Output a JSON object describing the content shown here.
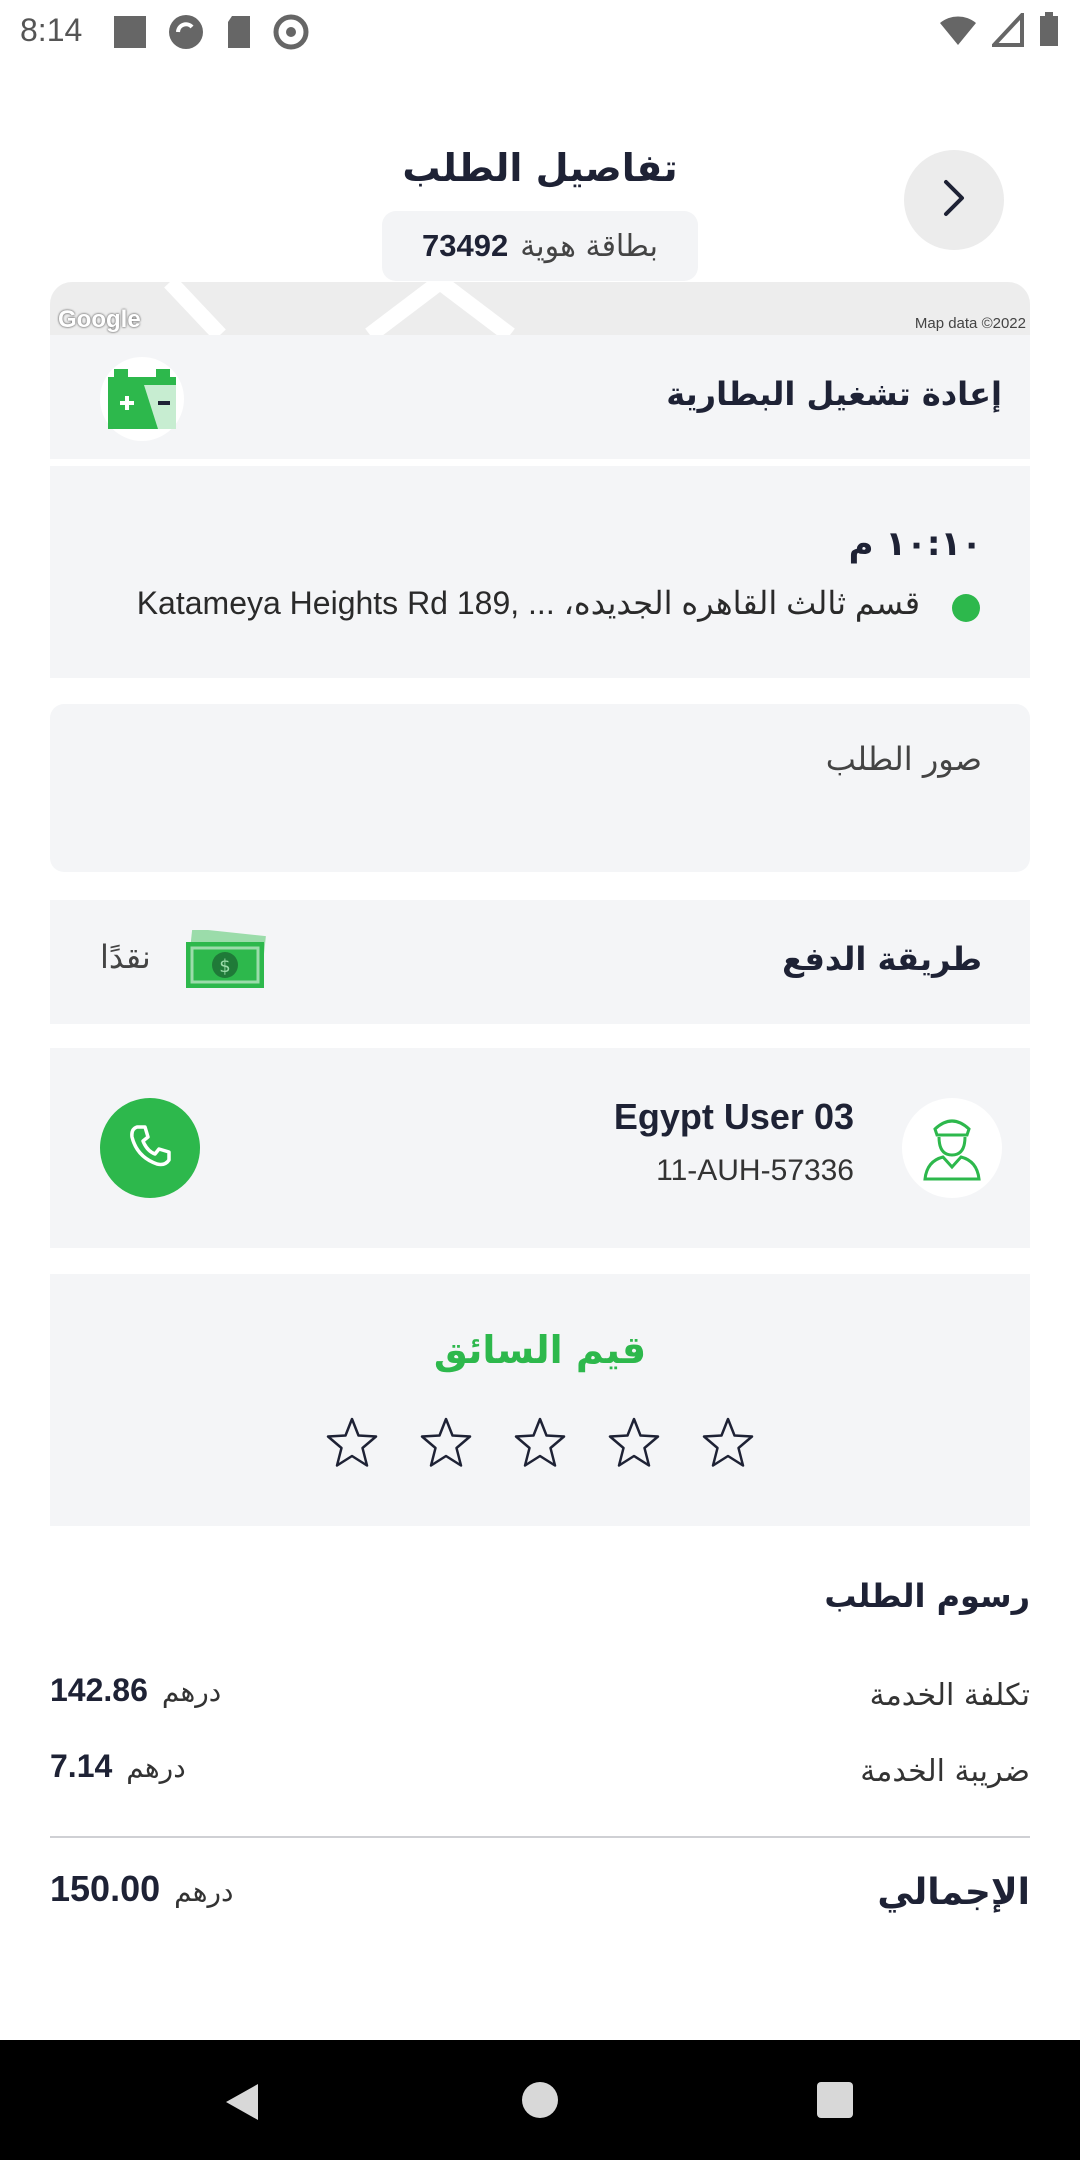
{
  "status_bar": {
    "time": "8:14"
  },
  "header": {
    "title": "تفاصيل الطلب",
    "id_label": "بطاقة هوية",
    "id_number": "73492"
  },
  "map": {
    "logo": "Google",
    "attribution": "Map data ©2022"
  },
  "service": {
    "name": "إعادة تشغيل البطارية",
    "icon": "battery-icon"
  },
  "location": {
    "time": "١٠:١٠ م",
    "address": "قسم ثالث القاهره الجديده، ... ,189 Katameya Heights Rd"
  },
  "photos": {
    "label": "صور الطلب"
  },
  "payment": {
    "label": "طريقة الدفع",
    "method": "نقدًا",
    "icon": "cash-icon"
  },
  "driver": {
    "name": "Egypt User  03",
    "plate": "11-AUH-57336",
    "call_icon": "phone-icon"
  },
  "rating": {
    "title": "قيم السائق",
    "stars": 5,
    "filled": 0
  },
  "fees": {
    "title": "رسوم الطلب",
    "rows": [
      {
        "label": "تكلفة الخدمة",
        "value": "142.86",
        "currency": "درهم"
      },
      {
        "label": "ضريبة الخدمة",
        "value": "7.14",
        "currency": "درهم"
      }
    ],
    "total": {
      "label": "الإجمالي",
      "value": "150.00",
      "currency": "درهم"
    }
  },
  "colors": {
    "accent": "#2db84c",
    "card_bg": "#f4f5f7",
    "text_dark": "#1e2235"
  }
}
